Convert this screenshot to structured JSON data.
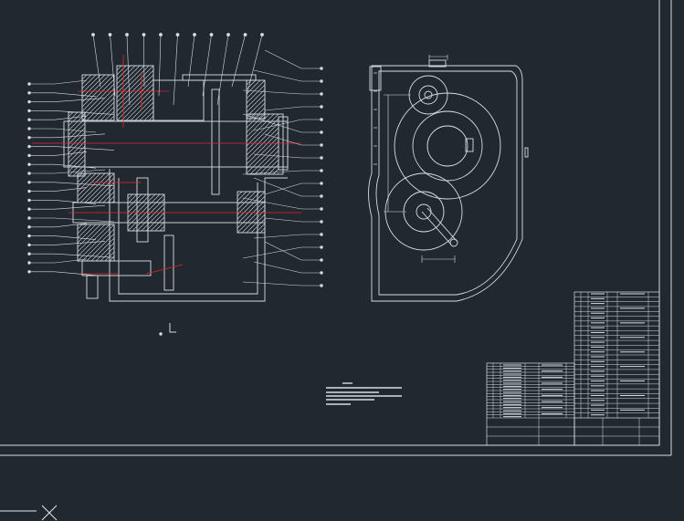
{
  "document": {
    "colors": {
      "background": "#212830",
      "line": "#d8dde2",
      "centerline": "#e02828",
      "hatch": "#c8ced4"
    },
    "icons": {
      "ucs": "ucs-axis-icon",
      "crosshair": "crosshair-cursor-icon"
    },
    "section_view": {
      "balloon_count_top": 11,
      "balloon_count_left": 22,
      "balloon_count_right": 18
    },
    "title_block": {
      "left_rows": 18,
      "right_rows": 26
    }
  }
}
